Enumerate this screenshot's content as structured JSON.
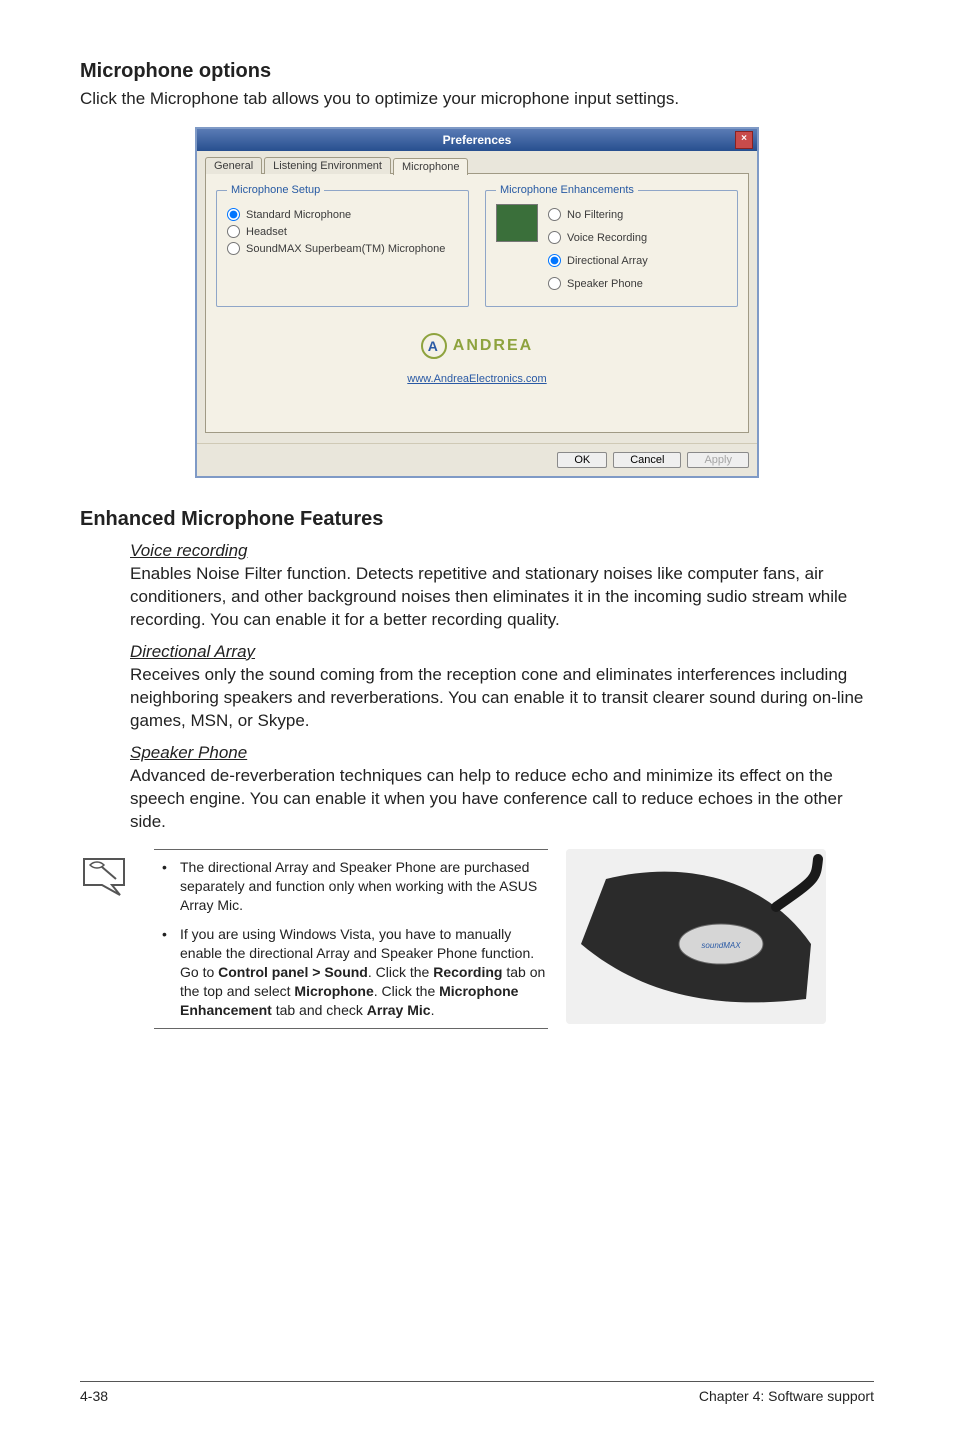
{
  "headings": {
    "mic_options": "Microphone options",
    "mic_options_lead": "Click the Microphone tab allows you to optimize your microphone input settings.",
    "enhanced": "Enhanced Microphone Features"
  },
  "dialog": {
    "title": "Preferences",
    "close_glyph": "×",
    "tabs": {
      "general": "General",
      "listening": "Listening Environment",
      "microphone": "Microphone"
    },
    "group_setup_legend": "Microphone Setup",
    "setup_options": {
      "standard": "Standard Microphone",
      "headset": "Headset",
      "soundmax": "SoundMAX Superbeam(TM) Microphone"
    },
    "group_enh_legend": "Microphone Enhancements",
    "enh_options": {
      "nofilter": "No Filtering",
      "voice": "Voice Recording",
      "dir": "Directional Array",
      "speaker": "Speaker Phone"
    },
    "andrea_brand": "ANDREA",
    "andrea_link": "www.AndreaElectronics.com",
    "buttons": {
      "ok": "OK",
      "cancel": "Cancel",
      "apply": "Apply"
    }
  },
  "features": {
    "voice_head": "Voice recording",
    "voice_body": "Enables Noise Filter function. Detects repetitive and stationary noises like computer fans, air conditioners, and other background noises then eliminates it in the incoming sudio stream while recording. You can enable it for a better recording quality.",
    "dir_head": "Directional Array",
    "dir_body": "Receives only the sound coming from the reception cone and eliminates interferences including neighboring speakers and reverberations. You can enable it to transit clearer sound during on-line games, MSN, or Skype.",
    "speaker_head": "Speaker Phone",
    "speaker_body": "Advanced de-reverberation techniques can help to reduce echo and minimize its effect on the speech engine. You can enable it when you have conference call to reduce echoes in the other side."
  },
  "notes": {
    "bullet1": "The directional Array and Speaker Phone are purchased separately and function only when working with the ASUS Array Mic.",
    "bullet2_pre": "If you are using Windows Vista, you have to manually enable the directional Array and Speaker Phone function. Go to ",
    "bullet2_bold1": "Control panel > Sound",
    "bullet2_mid1": ". Click the ",
    "bullet2_bold2": "Recording",
    "bullet2_mid2": " tab on the top and select ",
    "bullet2_bold3": "Microphone",
    "bullet2_mid3": ". Click the ",
    "bullet2_bold4": "Microphone Enhancement",
    "bullet2_mid4": " tab and check ",
    "bullet2_bold5": "Array Mic",
    "bullet2_end": "."
  },
  "footer": {
    "left": "4-38",
    "right": "Chapter 4: Software support"
  }
}
